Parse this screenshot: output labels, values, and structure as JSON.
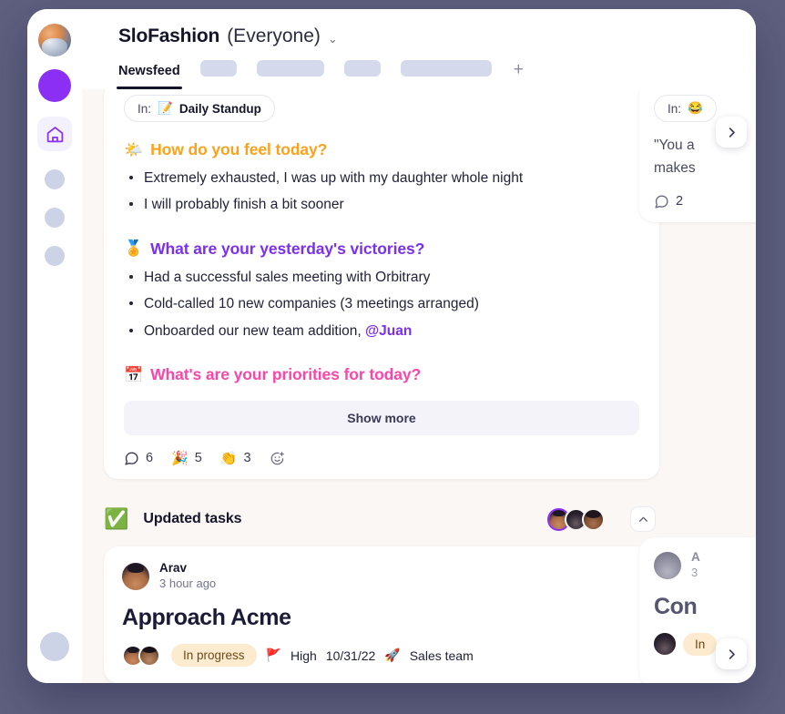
{
  "theme": {
    "outer_bg": "#5f6080",
    "app_bg": "#faf7f4",
    "accent_purple": "#8b2ff5",
    "heading_orange": "#faa21b",
    "heading_violet": "#7b2ff2",
    "heading_pink": "#fb46a9",
    "status_chip_bg": "#fcebcf"
  },
  "rail": {
    "avatar_name": "workspace-avatar",
    "items": [
      {
        "name": "home-icon",
        "active": true
      },
      {
        "name": "placeholder-dot-1",
        "active": false
      },
      {
        "name": "placeholder-dot-2",
        "active": false
      },
      {
        "name": "placeholder-dot-3",
        "active": false
      }
    ],
    "bottom_name": "user-avatar-placeholder"
  },
  "header": {
    "workspace": "SloFashion",
    "scope": "(Everyone)",
    "chevron": "⌄"
  },
  "tabs": {
    "active_label": "Newsfeed",
    "placeholders": [
      40,
      74,
      40,
      100
    ],
    "add_label": "+"
  },
  "post": {
    "in_label": "In:",
    "in_emoji": "📝",
    "in_channel": "Daily Standup",
    "questions": [
      {
        "emoji": "🌤️",
        "text": "How do you feel today?",
        "color": "#faa21b",
        "answers": [
          "Extremely exhausted, I was up with my daughter whole night",
          "I will probably finish a bit sooner"
        ]
      },
      {
        "emoji": "🏅",
        "text": "What are your yesterday's victories?",
        "color": "#7b2ff2",
        "answers": [
          "Had a successful sales meeting with Orbitrary",
          "Cold-called 10 new companies (3 meetings arranged)",
          "Onboarded our new team addition, @Juan"
        ],
        "mention": "@Juan"
      },
      {
        "emoji": "📅",
        "text": "What's are your priorities for today?",
        "color": "#fb46a9",
        "answers": []
      }
    ],
    "show_more": "Show more",
    "reactions": [
      {
        "icon": "comment-icon",
        "emoji": "",
        "count": "6"
      },
      {
        "icon": "party-popper",
        "emoji": "🎉",
        "count": "5"
      },
      {
        "icon": "clap",
        "emoji": "👏",
        "count": "3"
      },
      {
        "icon": "add-reaction-icon",
        "emoji": "",
        "count": ""
      }
    ]
  },
  "section": {
    "emoji": "✅",
    "title": "Updated tasks",
    "collapse_icon": "chevron-up"
  },
  "task": {
    "author": "Arav",
    "time": "3 hour ago",
    "title": "Approach Acme",
    "status": "In progress",
    "priority_emoji": "🚩",
    "priority": "High",
    "due_date": "10/31/22",
    "project_emoji": "🚀",
    "project": "Sales team"
  },
  "peek": {
    "card_one": {
      "in_label": "In:",
      "in_emoji": "😂",
      "quote_line_1": "\"You a",
      "quote_line_2": "makes",
      "comment_count": "2"
    },
    "card_two": {
      "author_partial": "A",
      "time_partial": "3",
      "title_partial": "Con",
      "status_partial": "In"
    },
    "arrow_icon": "chevron-right"
  }
}
